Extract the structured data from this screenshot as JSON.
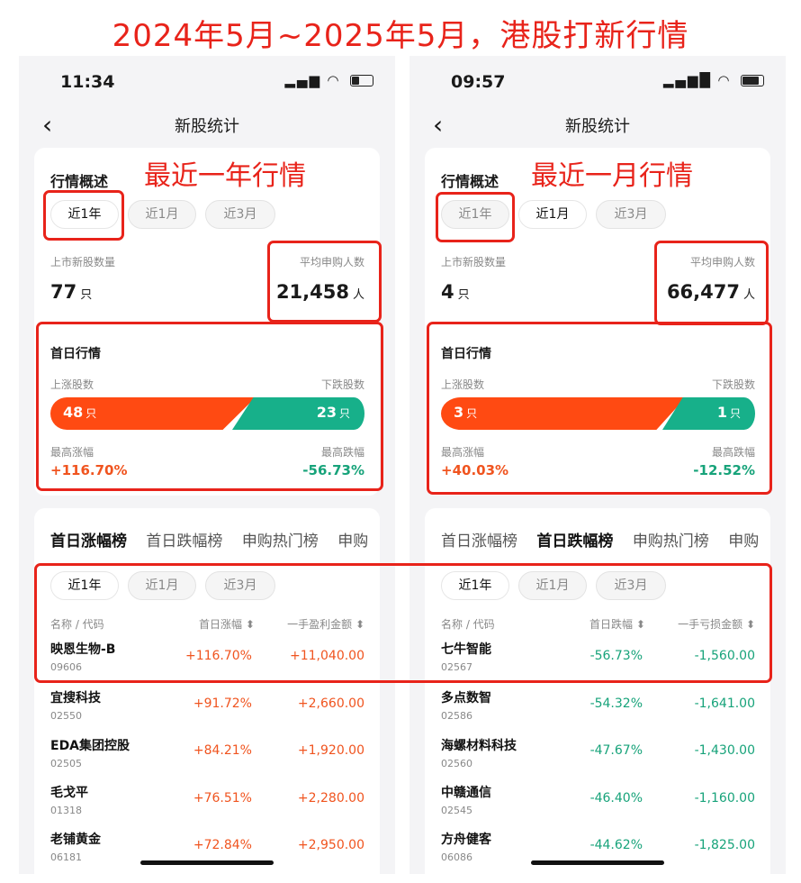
{
  "headline": "2024年5月~2025年5月，港股打新行情",
  "annot_year": "最近一年行情",
  "annot_month": "最近一月行情",
  "nav_title": "新股统计",
  "overview_title": "行情概述",
  "pill_year": "近1年",
  "pill_month": "近1月",
  "pill_3month": "近3月",
  "listed_label": "上市新股数量",
  "avg_label": "平均申购人数",
  "unit_zhi": "只",
  "unit_ren": "人",
  "firstday_title": "首日行情",
  "up_label": "上涨股数",
  "down_label": "下跌股数",
  "max_up_label": "最高涨幅",
  "max_down_label": "最高跌幅",
  "tabs": [
    "首日涨幅榜",
    "首日跌幅榜",
    "申购热门榜",
    "申购"
  ],
  "col_name": "名称 / 代码",
  "left": {
    "time": "11:34",
    "listed_count": "77",
    "avg_subscribers": "21,458",
    "up_count": "48",
    "down_count": "23",
    "up_fraction": 0.6234,
    "max_up": "+116.70%",
    "max_down": "-56.73%",
    "col_pct": "首日涨幅 ⬍",
    "col_amt": "一手盈利金额 ⬍",
    "rows": [
      {
        "name": "映恩生物-B",
        "code": "09606",
        "pct": "+116.70%",
        "amt": "+11,040.00"
      },
      {
        "name": "宜搜科技",
        "code": "02550",
        "pct": "+91.72%",
        "amt": "+2,660.00"
      },
      {
        "name": "EDA集团控股",
        "code": "02505",
        "pct": "+84.21%",
        "amt": "+1,920.00"
      },
      {
        "name": "毛戈平",
        "code": "01318",
        "pct": "+76.51%",
        "amt": "+2,280.00"
      },
      {
        "name": "老铺黄金",
        "code": "06181",
        "pct": "+72.84%",
        "amt": "+2,950.00"
      }
    ]
  },
  "right": {
    "time": "09:57",
    "listed_count": "4",
    "avg_subscribers": "66,477",
    "up_count": "3",
    "down_count": "1",
    "up_fraction": 0.75,
    "max_up": "+40.03%",
    "max_down": "-12.52%",
    "col_pct": "首日跌幅 ⬍",
    "col_amt": "一手亏损金额 ⬍",
    "rows": [
      {
        "name": "七牛智能",
        "code": "02567",
        "pct": "-56.73%",
        "amt": "-1,560.00"
      },
      {
        "name": "多点数智",
        "code": "02586",
        "pct": "-54.32%",
        "amt": "-1,641.00"
      },
      {
        "name": "海螺材料科技",
        "code": "02560",
        "pct": "-47.67%",
        "amt": "-1,430.00"
      },
      {
        "name": "中赣通信",
        "code": "02545",
        "pct": "-46.40%",
        "amt": "-1,160.00"
      },
      {
        "name": "方舟健客",
        "code": "06086",
        "pct": "-44.62%",
        "amt": "-1,825.00"
      }
    ]
  },
  "colors": {
    "accent_red": "#e8231a",
    "up_orange": "#ff4a12",
    "down_green": "#17b08a"
  }
}
